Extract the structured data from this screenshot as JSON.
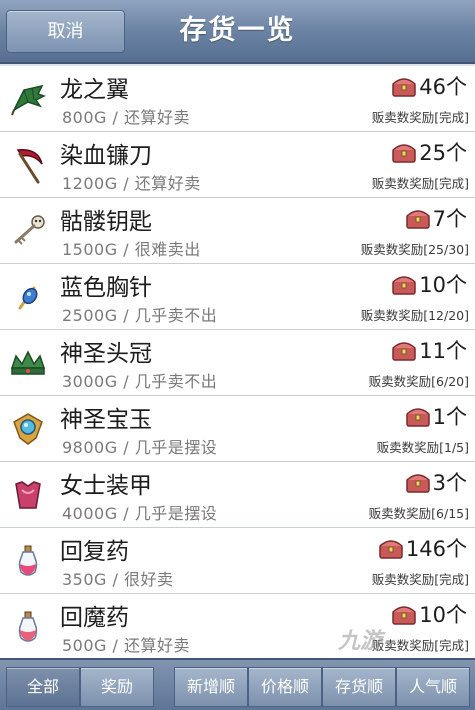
{
  "header": {
    "cancel_label": "取消",
    "title": "存货一览"
  },
  "items": [
    {
      "name": "龙之翼",
      "price": "800G",
      "sep": "/",
      "status": "还算好卖",
      "count": "46个",
      "reward": "贩卖数奖励[完成]",
      "icon": "dragon-wing-icon"
    },
    {
      "name": "染血镰刀",
      "price": "1200G",
      "sep": "/",
      "status": "还算好卖",
      "count": "25个",
      "reward": "贩卖数奖励[完成]",
      "icon": "bloody-scythe-icon"
    },
    {
      "name": "骷髅钥匙",
      "price": "1500G",
      "sep": "/",
      "status": "很难卖出",
      "count": "7个",
      "reward": "贩卖数奖励[25/30]",
      "icon": "skull-key-icon"
    },
    {
      "name": "蓝色胸针",
      "price": "2500G",
      "sep": "/",
      "status": "几乎卖不出",
      "count": "10个",
      "reward": "贩卖数奖励[12/20]",
      "icon": "blue-brooch-icon"
    },
    {
      "name": "神圣头冠",
      "price": "3000G",
      "sep": "/",
      "status": "几乎卖不出",
      "count": "11个",
      "reward": "贩卖数奖励[6/20]",
      "icon": "holy-crown-icon"
    },
    {
      "name": "神圣宝玉",
      "price": "9800G",
      "sep": "/",
      "status": "几乎是摆设",
      "count": "1个",
      "reward": "贩卖数奖励[1/5]",
      "icon": "holy-jewel-icon"
    },
    {
      "name": "女士装甲",
      "price": "4000G",
      "sep": "/",
      "status": "几乎是摆设",
      "count": "3个",
      "reward": "贩卖数奖励[6/15]",
      "icon": "lady-armor-icon"
    },
    {
      "name": "回复药",
      "price": "350G",
      "sep": "/",
      "status": "很好卖",
      "count": "146个",
      "reward": "贩卖数奖励[完成]",
      "icon": "healing-potion-icon"
    },
    {
      "name": "回魔药",
      "price": "500G",
      "sep": "/",
      "status": "还算好卖",
      "count": "10个",
      "reward": "贩卖数奖励[完成]",
      "icon": "mana-potion-icon"
    }
  ],
  "bottom": {
    "all_label": "全部",
    "reward_label": "奖励",
    "sort_new_label": "新增顺",
    "sort_price_label": "价格顺",
    "sort_stock_label": "存货顺",
    "sort_popular_label": "人气顺"
  },
  "watermark": "九游"
}
